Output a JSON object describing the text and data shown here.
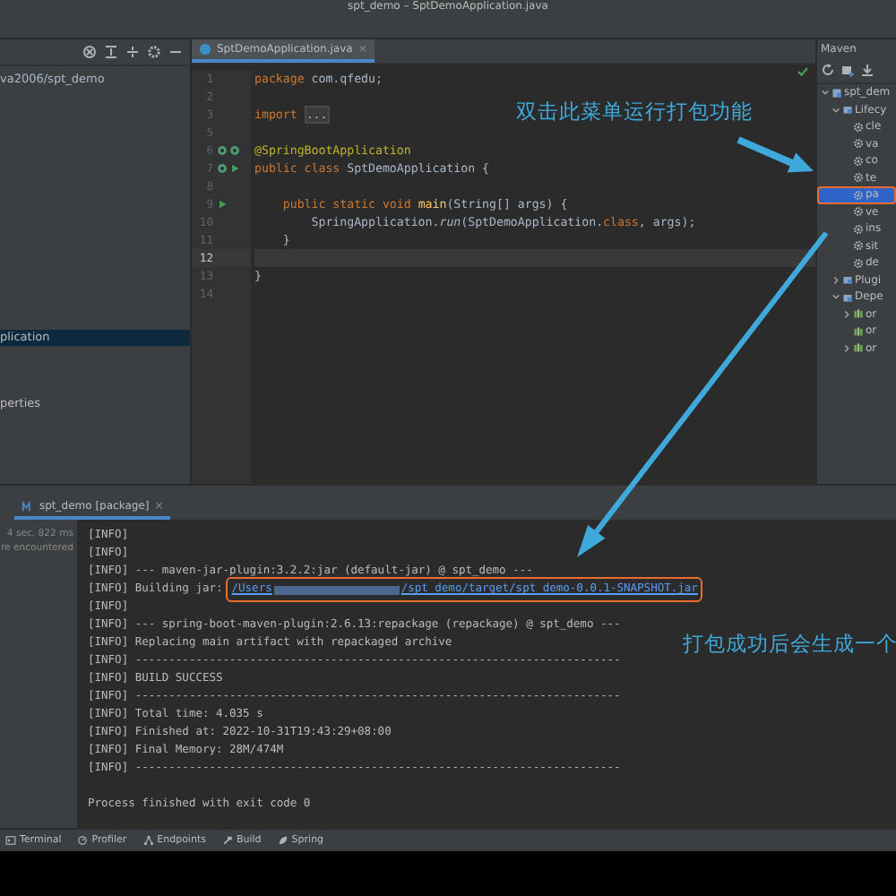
{
  "window": {
    "title": "spt_demo – SptDemoApplication.java"
  },
  "project_panel": {
    "path": "va2006/spt_demo",
    "items": [
      {
        "label": "plication",
        "selected": true
      },
      {
        "label": "perties",
        "selected": false
      }
    ]
  },
  "editor": {
    "tab": {
      "label": "SptDemoApplication.java",
      "selected": true,
      "close": "×"
    },
    "lines": [
      {
        "number": "1",
        "tokens": [
          {
            "text": "package",
            "kind": "keyword"
          },
          {
            "text": " com.qfedu;",
            "kind": "plain"
          }
        ]
      },
      {
        "number": "2"
      },
      {
        "number": "3",
        "tokens": [
          {
            "text": "import",
            "kind": "keyword"
          },
          {
            "text": "...",
            "kind": "folded"
          }
        ]
      },
      {
        "number": "5"
      },
      {
        "number": "6",
        "markers": [
          {
            "kind": "bean"
          },
          {
            "kind": "bean"
          }
        ],
        "tokens": [
          {
            "text": "@SpringBootApplication",
            "kind": "annotation"
          }
        ]
      },
      {
        "number": "7",
        "markers": [
          {
            "kind": "bean"
          },
          {
            "kind": "run"
          }
        ],
        "tokens": [
          {
            "text": "public class",
            "kind": "keyword"
          },
          {
            "text": " SptDemoApplication {",
            "kind": "plain"
          }
        ]
      },
      {
        "number": "8"
      },
      {
        "number": "9",
        "markers": [
          {
            "kind": "run"
          }
        ],
        "tokens": [
          {
            "text": "    public static void",
            "kind": "keyword"
          },
          {
            "text": " main",
            "kind": "method"
          },
          {
            "text": "(String[] args) {",
            "kind": "plain"
          }
        ]
      },
      {
        "number": "10",
        "tokens": [
          {
            "text": "        SpringApplication.",
            "kind": "plain"
          },
          {
            "text": "run",
            "kind": "italic"
          },
          {
            "text": "(SptDemoApplication.",
            "kind": "plain"
          },
          {
            "text": "class",
            "kind": "keyword"
          },
          {
            "text": ", args);",
            "kind": "plain"
          }
        ]
      },
      {
        "number": "11",
        "tokens": [
          {
            "text": "    }",
            "kind": "plain"
          }
        ]
      },
      {
        "number": "12",
        "current": true
      },
      {
        "number": "13",
        "tokens": [
          {
            "text": "}",
            "kind": "plain"
          }
        ]
      },
      {
        "number": "14"
      }
    ]
  },
  "maven": {
    "title": "Maven",
    "tree": [
      {
        "label": "spt_dem",
        "kind": "project",
        "expanded": true,
        "selected": false,
        "highlighted": false,
        "children": [
          {
            "label": "Lifecy",
            "kind": "folder",
            "expanded": true,
            "selected": false,
            "highlighted": false,
            "children": [
              {
                "label": "cle",
                "kind": "goal",
                "selected": false,
                "highlighted": false
              },
              {
                "label": "va",
                "kind": "goal",
                "selected": false,
                "highlighted": false
              },
              {
                "label": "co",
                "kind": "goal",
                "selected": false,
                "highlighted": false
              },
              {
                "label": "te",
                "kind": "goal",
                "selected": false,
                "highlighted": false
              },
              {
                "label": "pa",
                "kind": "goal",
                "selected": true,
                "highlighted": true
              },
              {
                "label": "ve",
                "kind": "goal",
                "selected": false,
                "highlighted": false
              },
              {
                "label": "ins",
                "kind": "goal",
                "selected": false,
                "highlighted": false
              },
              {
                "label": "sit",
                "kind": "goal",
                "selected": false,
                "highlighted": false
              },
              {
                "label": "de",
                "kind": "goal",
                "selected": false,
                "highlighted": false
              }
            ]
          },
          {
            "label": "Plugi",
            "kind": "folder",
            "expanded": false,
            "selected": false,
            "highlighted": false
          },
          {
            "label": "Depe",
            "kind": "folder",
            "expanded": true,
            "selected": false,
            "highlighted": false,
            "children": [
              {
                "label": "or",
                "kind": "dependency",
                "expanded": false,
                "selected": false,
                "highlighted": false
              },
              {
                "label": "or",
                "kind": "dependency",
                "selected": false,
                "highlighted": false
              },
              {
                "label": "or",
                "kind": "dependency",
                "expanded": false,
                "selected": false,
                "highlighted": false
              }
            ]
          }
        ]
      }
    ]
  },
  "run_panel": {
    "tab": {
      "label": "spt_demo [package]",
      "selected": true,
      "close": "×"
    },
    "summary": [
      "4 sec, 822 ms",
      "re encountered"
    ],
    "console": [
      {
        "kind": "text",
        "text": "[INFO]"
      },
      {
        "kind": "text",
        "text": "[INFO]"
      },
      {
        "kind": "text",
        "text": "[INFO] --- maven-jar-plugin:3.2.2:jar (default-jar) @ spt_demo ---"
      },
      {
        "kind": "link",
        "text": "[INFO] Building jar:",
        "link": {
          "parts": [
            "/Users",
            "/spt_demo/target/spt_demo-0.0.1-SNAPSHOT.jar"
          ],
          "highlighted": true
        }
      },
      {
        "kind": "text",
        "text": "[INFO]"
      },
      {
        "kind": "text",
        "text": "[INFO] --- spring-boot-maven-plugin:2.6.13:repackage (repackage) @ spt_demo ---"
      },
      {
        "kind": "text",
        "text": "[INFO] Replacing main artifact with repackaged archive"
      },
      {
        "kind": "text",
        "text": "[INFO] ------------------------------------------------------------------------"
      },
      {
        "kind": "text",
        "text": "[INFO] BUILD SUCCESS"
      },
      {
        "kind": "text",
        "text": "[INFO] ------------------------------------------------------------------------"
      },
      {
        "kind": "text",
        "text": "[INFO] Total time: 4.035 s"
      },
      {
        "kind": "text",
        "text": "[INFO] Finished at: 2022-10-31T19:43:29+08:00"
      },
      {
        "kind": "text",
        "text": "[INFO] Final Memory: 28M/474M"
      },
      {
        "kind": "text",
        "text": "[INFO] ------------------------------------------------------------------------"
      },
      {
        "kind": "exit",
        "text": "Process finished with exit code 0"
      }
    ]
  },
  "tool_strip": [
    {
      "label": "Terminal"
    },
    {
      "label": "Profiler"
    },
    {
      "label": "Endpoints"
    },
    {
      "label": "Build"
    },
    {
      "label": "Spring"
    }
  ],
  "annotations": [
    {
      "text": "双击此菜单运行打包功能"
    },
    {
      "text": "打包成功后会生成一个"
    }
  ]
}
